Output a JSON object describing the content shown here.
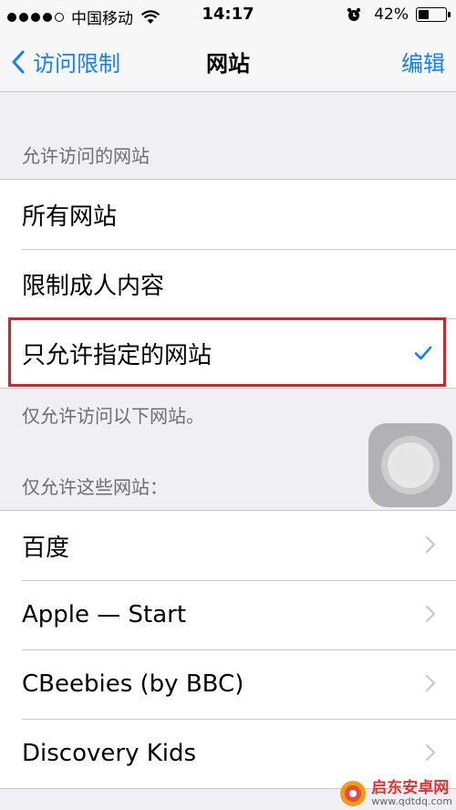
{
  "status_bar": {
    "carrier": "中国移动",
    "time": "14:17",
    "battery_percent": "42%",
    "battery_level": 0.42,
    "signal_bars": 5
  },
  "nav": {
    "back_label": "访问限制",
    "title": "网站",
    "edit_label": "编辑",
    "accent_color": "#157efb"
  },
  "section_allowed": {
    "header": "允许访问的网站",
    "options": [
      {
        "label": "所有网站",
        "selected": false
      },
      {
        "label": "限制成人内容",
        "selected": false
      },
      {
        "label": "只允许指定的网站",
        "selected": true
      }
    ],
    "footer": "仅允许访问以下网站。"
  },
  "section_sites": {
    "header": "仅允许这些网站：",
    "sites": [
      {
        "label": "百度"
      },
      {
        "label": "Apple — Start"
      },
      {
        "label": "CBeebies (by BBC)"
      },
      {
        "label": "Discovery Kids"
      }
    ]
  },
  "highlight_color": "#d0232e",
  "watermark": {
    "name": "启东安卓网",
    "url": "www.qdtdq.com"
  }
}
